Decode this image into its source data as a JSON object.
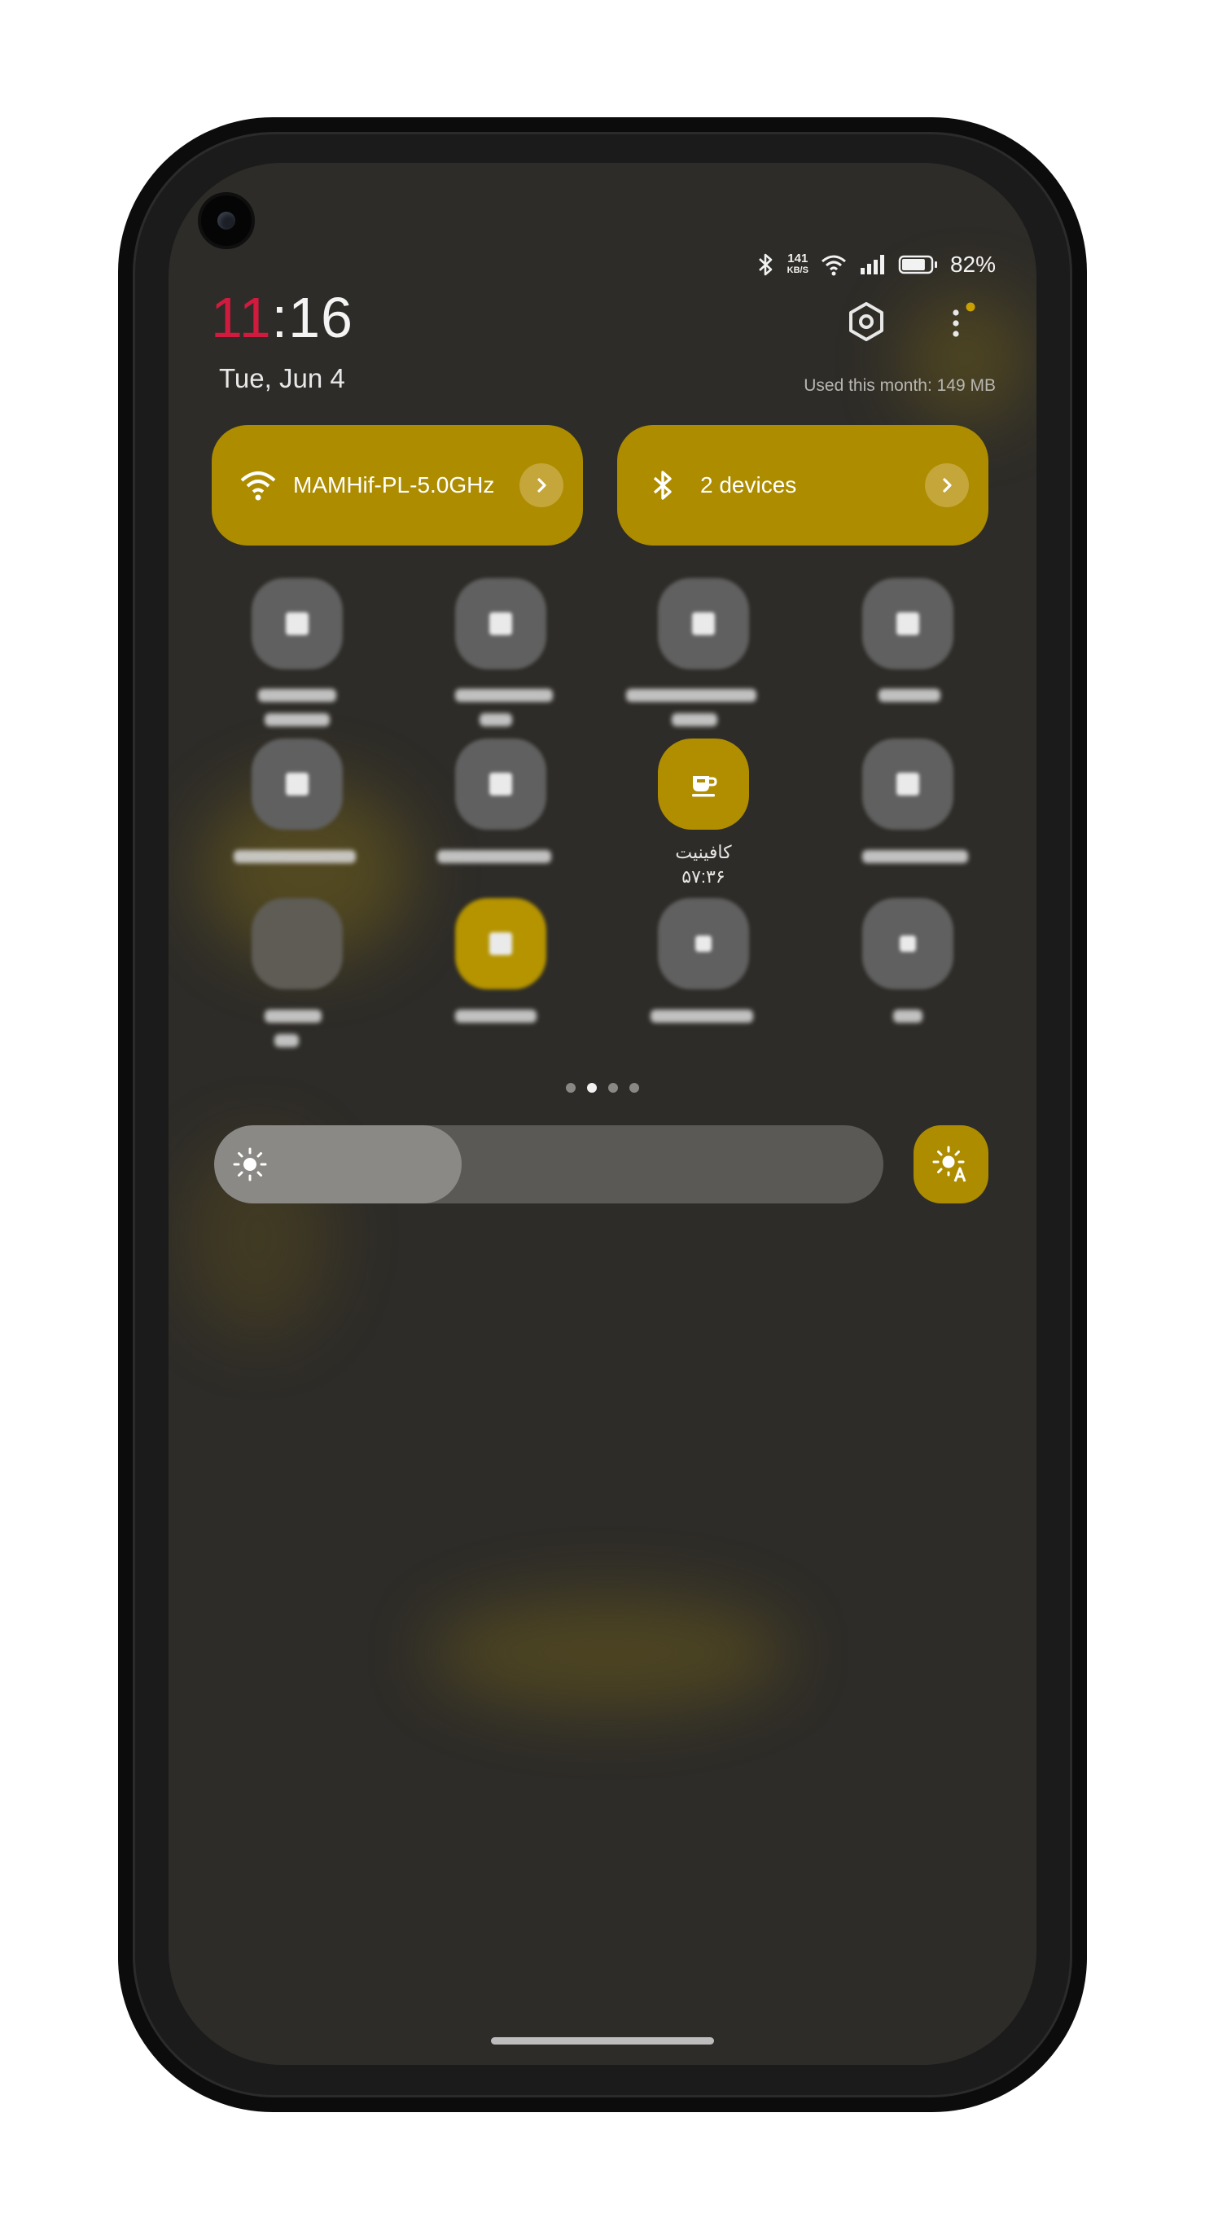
{
  "status_bar": {
    "net_speed_value": "141",
    "net_speed_unit": "KB/S",
    "battery_percent": "82%",
    "battery_level": 0.82,
    "icons": [
      "bluetooth-icon",
      "wifi-icon",
      "cellular-signal-icon",
      "battery-icon"
    ]
  },
  "header": {
    "time_hour": "11",
    "time_rest": ":16",
    "date": "Tue, Jun 4",
    "data_usage": "Used this month: 149 MB",
    "settings_icon": "gear-icon",
    "menu_icon": "more-vertical-icon"
  },
  "connectivity": {
    "wifi": {
      "label": "MAMHif-PL-5.0GHz",
      "icon": "wifi-icon"
    },
    "bluetooth": {
      "label": "2 devices",
      "icon": "bluetooth-icon"
    }
  },
  "quick_tiles": {
    "caffeine": {
      "label": "کافینیت",
      "sublabel": "۵۷:۳۶",
      "icon": "coffee-cup-icon"
    }
  },
  "pager": {
    "pages": 4,
    "active_index": 1
  },
  "brightness": {
    "level": 0.37,
    "icon": "sun-icon",
    "auto_icon": "auto-brightness-icon"
  },
  "colors": {
    "accent": "#ad8c00",
    "clock_hour": "#d01a3e",
    "panel": "#2e2c28"
  }
}
